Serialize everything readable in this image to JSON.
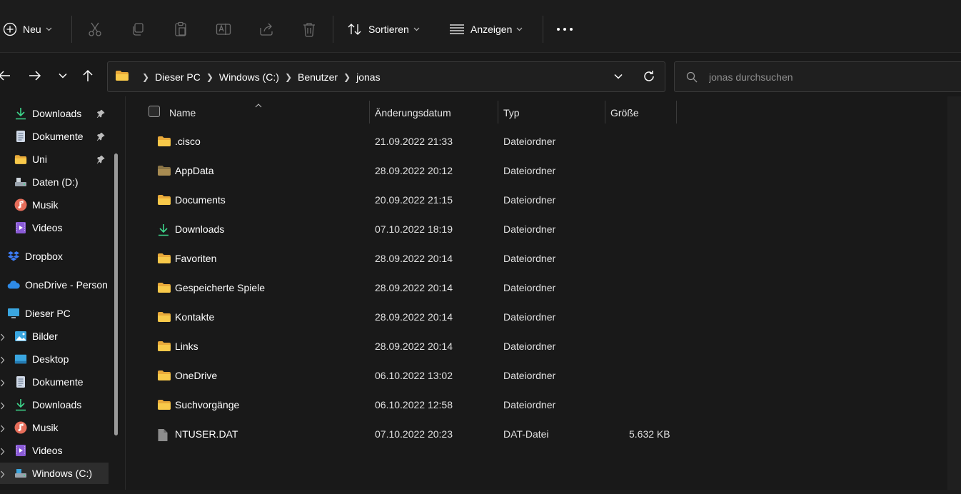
{
  "toolbar": {
    "new_label": "Neu",
    "sort_label": "Sortieren",
    "view_label": "Anzeigen"
  },
  "address": {
    "crumbs": [
      "Dieser PC",
      "Windows (C:)",
      "Benutzer",
      "jonas"
    ]
  },
  "search": {
    "placeholder": "jonas durchsuchen"
  },
  "sidebar": {
    "items": [
      {
        "label": "Downloads",
        "icon": "download-icon"
      },
      {
        "label": "Dokumente",
        "icon": "document-icon"
      },
      {
        "label": "Uni",
        "icon": "folder-icon"
      },
      {
        "label": "Daten (D:)",
        "icon": "drive-icon"
      },
      {
        "label": "Musik",
        "icon": "music-icon"
      },
      {
        "label": "Videos",
        "icon": "video-icon"
      },
      {
        "label": "Dropbox",
        "icon": "dropbox-icon"
      },
      {
        "label": "OneDrive - Person",
        "icon": "cloud-icon"
      },
      {
        "label": "Dieser PC",
        "icon": "monitor-icon"
      },
      {
        "label": "Bilder",
        "icon": "picture-icon"
      },
      {
        "label": "Desktop",
        "icon": "desktop-icon"
      },
      {
        "label": "Dokumente",
        "icon": "document-icon"
      },
      {
        "label": "Downloads",
        "icon": "download-icon"
      },
      {
        "label": "Musik",
        "icon": "music-icon"
      },
      {
        "label": "Videos",
        "icon": "video-icon"
      },
      {
        "label": "Windows (C:)",
        "icon": "drive-icon"
      }
    ]
  },
  "columns": {
    "name": "Name",
    "date": "Änderungsdatum",
    "type": "Typ",
    "size": "Größe"
  },
  "files": [
    {
      "name": ".cisco",
      "date": "21.09.2022 21:33",
      "type": "Dateiordner",
      "size": "",
      "icon": "folder-icon"
    },
    {
      "name": "AppData",
      "date": "28.09.2022 20:12",
      "type": "Dateiordner",
      "size": "",
      "icon": "hidden-folder-icon"
    },
    {
      "name": "Documents",
      "date": "20.09.2022 21:15",
      "type": "Dateiordner",
      "size": "",
      "icon": "folder-icon"
    },
    {
      "name": "Downloads",
      "date": "07.10.2022 18:19",
      "type": "Dateiordner",
      "size": "",
      "icon": "download-icon"
    },
    {
      "name": "Favoriten",
      "date": "28.09.2022 20:14",
      "type": "Dateiordner",
      "size": "",
      "icon": "folder-icon"
    },
    {
      "name": "Gespeicherte Spiele",
      "date": "28.09.2022 20:14",
      "type": "Dateiordner",
      "size": "",
      "icon": "folder-icon"
    },
    {
      "name": "Kontakte",
      "date": "28.09.2022 20:14",
      "type": "Dateiordner",
      "size": "",
      "icon": "folder-icon"
    },
    {
      "name": "Links",
      "date": "28.09.2022 20:14",
      "type": "Dateiordner",
      "size": "",
      "icon": "folder-icon"
    },
    {
      "name": "OneDrive",
      "date": "06.10.2022 13:02",
      "type": "Dateiordner",
      "size": "",
      "icon": "folder-icon"
    },
    {
      "name": "Suchvorgänge",
      "date": "06.10.2022 12:58",
      "type": "Dateiordner",
      "size": "",
      "icon": "folder-icon"
    },
    {
      "name": "NTUSER.DAT",
      "date": "07.10.2022 20:23",
      "type": "DAT-Datei",
      "size": "5.632 KB",
      "icon": "file-icon"
    }
  ],
  "colors": {
    "folder": "#F8C94A",
    "accent": "#60CDFF",
    "download_green": "#3DD68C"
  }
}
